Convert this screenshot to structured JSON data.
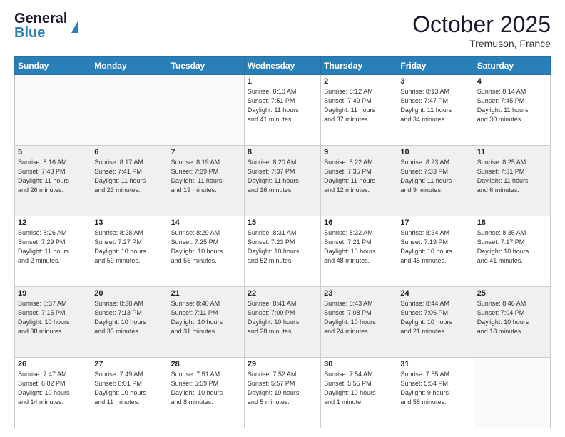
{
  "header": {
    "logo_line1": "General",
    "logo_line2": "Blue",
    "month_title": "October 2025",
    "location": "Tremuson, France"
  },
  "days_of_week": [
    "Sunday",
    "Monday",
    "Tuesday",
    "Wednesday",
    "Thursday",
    "Friday",
    "Saturday"
  ],
  "weeks": [
    [
      {
        "day": "",
        "info": ""
      },
      {
        "day": "",
        "info": ""
      },
      {
        "day": "",
        "info": ""
      },
      {
        "day": "1",
        "info": "Sunrise: 8:10 AM\nSunset: 7:51 PM\nDaylight: 11 hours\nand 41 minutes."
      },
      {
        "day": "2",
        "info": "Sunrise: 8:12 AM\nSunset: 7:49 PM\nDaylight: 11 hours\nand 37 minutes."
      },
      {
        "day": "3",
        "info": "Sunrise: 8:13 AM\nSunset: 7:47 PM\nDaylight: 11 hours\nand 34 minutes."
      },
      {
        "day": "4",
        "info": "Sunrise: 8:14 AM\nSunset: 7:45 PM\nDaylight: 11 hours\nand 30 minutes."
      }
    ],
    [
      {
        "day": "5",
        "info": "Sunrise: 8:16 AM\nSunset: 7:43 PM\nDaylight: 11 hours\nand 26 minutes."
      },
      {
        "day": "6",
        "info": "Sunrise: 8:17 AM\nSunset: 7:41 PM\nDaylight: 11 hours\nand 23 minutes."
      },
      {
        "day": "7",
        "info": "Sunrise: 8:19 AM\nSunset: 7:39 PM\nDaylight: 11 hours\nand 19 minutes."
      },
      {
        "day": "8",
        "info": "Sunrise: 8:20 AM\nSunset: 7:37 PM\nDaylight: 11 hours\nand 16 minutes."
      },
      {
        "day": "9",
        "info": "Sunrise: 8:22 AM\nSunset: 7:35 PM\nDaylight: 11 hours\nand 12 minutes."
      },
      {
        "day": "10",
        "info": "Sunrise: 8:23 AM\nSunset: 7:33 PM\nDaylight: 11 hours\nand 9 minutes."
      },
      {
        "day": "11",
        "info": "Sunrise: 8:25 AM\nSunset: 7:31 PM\nDaylight: 11 hours\nand 6 minutes."
      }
    ],
    [
      {
        "day": "12",
        "info": "Sunrise: 8:26 AM\nSunset: 7:29 PM\nDaylight: 11 hours\nand 2 minutes."
      },
      {
        "day": "13",
        "info": "Sunrise: 8:28 AM\nSunset: 7:27 PM\nDaylight: 10 hours\nand 59 minutes."
      },
      {
        "day": "14",
        "info": "Sunrise: 8:29 AM\nSunset: 7:25 PM\nDaylight: 10 hours\nand 55 minutes."
      },
      {
        "day": "15",
        "info": "Sunrise: 8:31 AM\nSunset: 7:23 PM\nDaylight: 10 hours\nand 52 minutes."
      },
      {
        "day": "16",
        "info": "Sunrise: 8:32 AM\nSunset: 7:21 PM\nDaylight: 10 hours\nand 48 minutes."
      },
      {
        "day": "17",
        "info": "Sunrise: 8:34 AM\nSunset: 7:19 PM\nDaylight: 10 hours\nand 45 minutes."
      },
      {
        "day": "18",
        "info": "Sunrise: 8:35 AM\nSunset: 7:17 PM\nDaylight: 10 hours\nand 41 minutes."
      }
    ],
    [
      {
        "day": "19",
        "info": "Sunrise: 8:37 AM\nSunset: 7:15 PM\nDaylight: 10 hours\nand 38 minutes."
      },
      {
        "day": "20",
        "info": "Sunrise: 8:38 AM\nSunset: 7:13 PM\nDaylight: 10 hours\nand 35 minutes."
      },
      {
        "day": "21",
        "info": "Sunrise: 8:40 AM\nSunset: 7:11 PM\nDaylight: 10 hours\nand 31 minutes."
      },
      {
        "day": "22",
        "info": "Sunrise: 8:41 AM\nSunset: 7:09 PM\nDaylight: 10 hours\nand 28 minutes."
      },
      {
        "day": "23",
        "info": "Sunrise: 8:43 AM\nSunset: 7:08 PM\nDaylight: 10 hours\nand 24 minutes."
      },
      {
        "day": "24",
        "info": "Sunrise: 8:44 AM\nSunset: 7:06 PM\nDaylight: 10 hours\nand 21 minutes."
      },
      {
        "day": "25",
        "info": "Sunrise: 8:46 AM\nSunset: 7:04 PM\nDaylight: 10 hours\nand 18 minutes."
      }
    ],
    [
      {
        "day": "26",
        "info": "Sunrise: 7:47 AM\nSunset: 6:02 PM\nDaylight: 10 hours\nand 14 minutes."
      },
      {
        "day": "27",
        "info": "Sunrise: 7:49 AM\nSunset: 6:01 PM\nDaylight: 10 hours\nand 11 minutes."
      },
      {
        "day": "28",
        "info": "Sunrise: 7:51 AM\nSunset: 5:59 PM\nDaylight: 10 hours\nand 8 minutes."
      },
      {
        "day": "29",
        "info": "Sunrise: 7:52 AM\nSunset: 5:57 PM\nDaylight: 10 hours\nand 5 minutes."
      },
      {
        "day": "30",
        "info": "Sunrise: 7:54 AM\nSunset: 5:55 PM\nDaylight: 10 hours\nand 1 minute."
      },
      {
        "day": "31",
        "info": "Sunrise: 7:55 AM\nSunset: 5:54 PM\nDaylight: 9 hours\nand 58 minutes."
      },
      {
        "day": "",
        "info": ""
      }
    ]
  ]
}
